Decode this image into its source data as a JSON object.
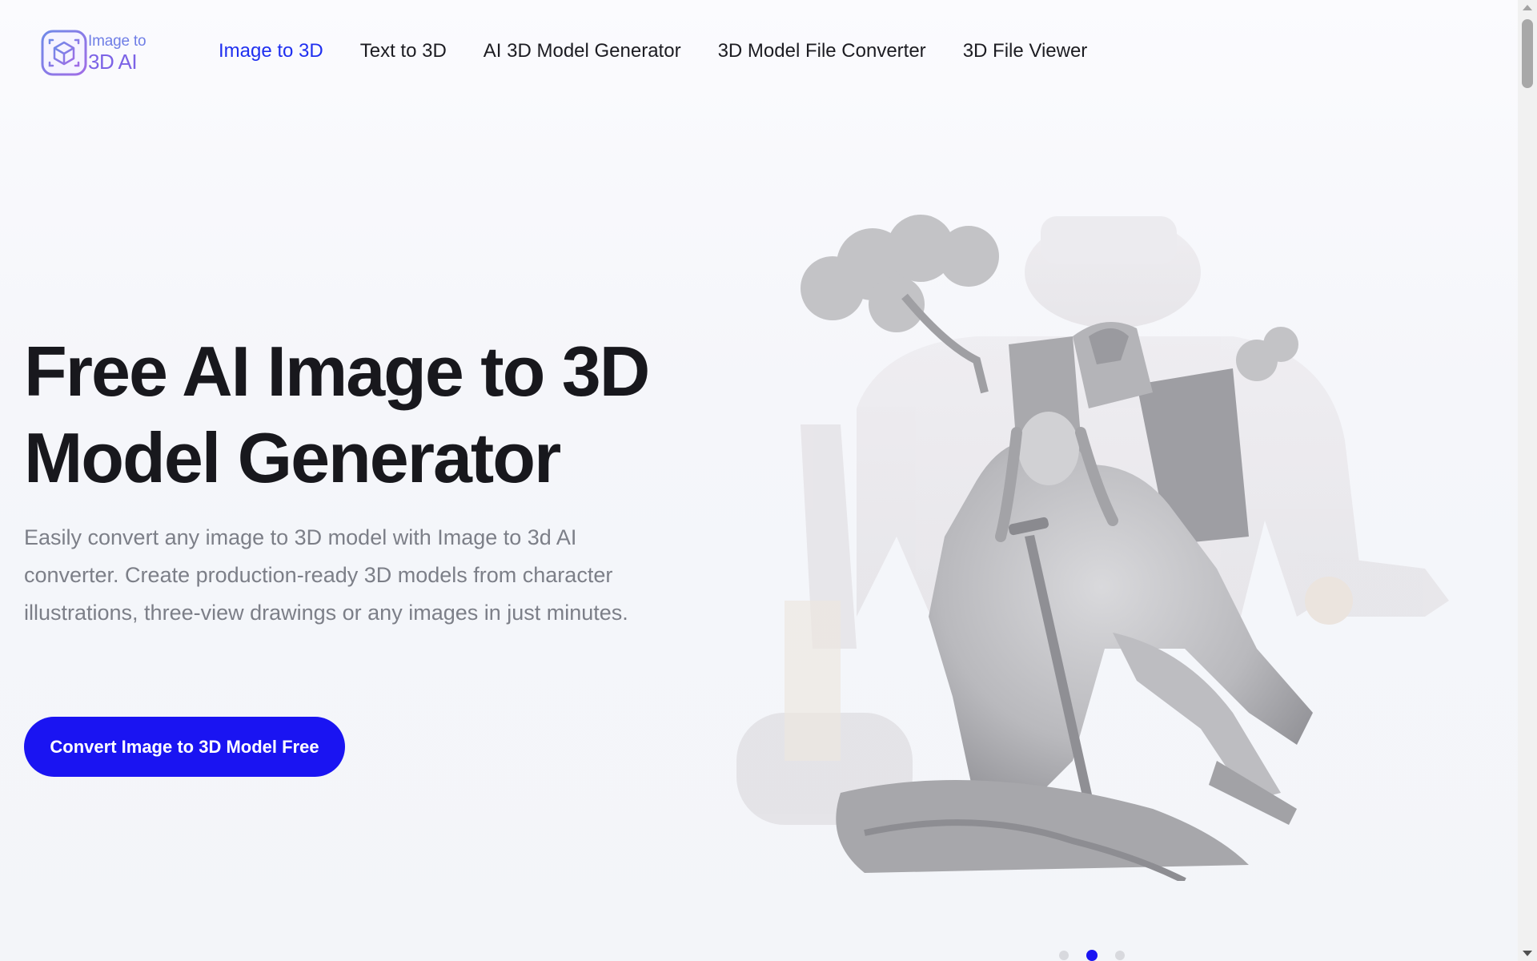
{
  "logo": {
    "line1": "Image to",
    "line2": "3D AI"
  },
  "nav": [
    {
      "label": "Image to 3D",
      "active": true
    },
    {
      "label": "Text to 3D",
      "active": false
    },
    {
      "label": "AI 3D Model Generator",
      "active": false
    },
    {
      "label": "3D Model File Converter",
      "active": false
    },
    {
      "label": "3D File Viewer",
      "active": false
    }
  ],
  "hero": {
    "title_line1": "Free AI Image to 3D",
    "title_line2": "Model Generator",
    "description": "Easily convert any image to 3D model with Image to 3d AI converter. Create production-ready 3D models from character illustrations, three-view drawings or any images in just minutes.",
    "cta_label": "Convert Image to 3D Model Free"
  },
  "carousel": {
    "count": 3,
    "active_index": 1
  },
  "colors": {
    "accent": "#1a14f2",
    "nav_active": "#1f2ff0",
    "title": "#18181d",
    "body_text": "#7c7f88",
    "logo_gradient_start": "#6f7ee6",
    "logo_gradient_end": "#8a5ce6"
  },
  "icons": {
    "logo": "3d-cube-scan-icon"
  }
}
